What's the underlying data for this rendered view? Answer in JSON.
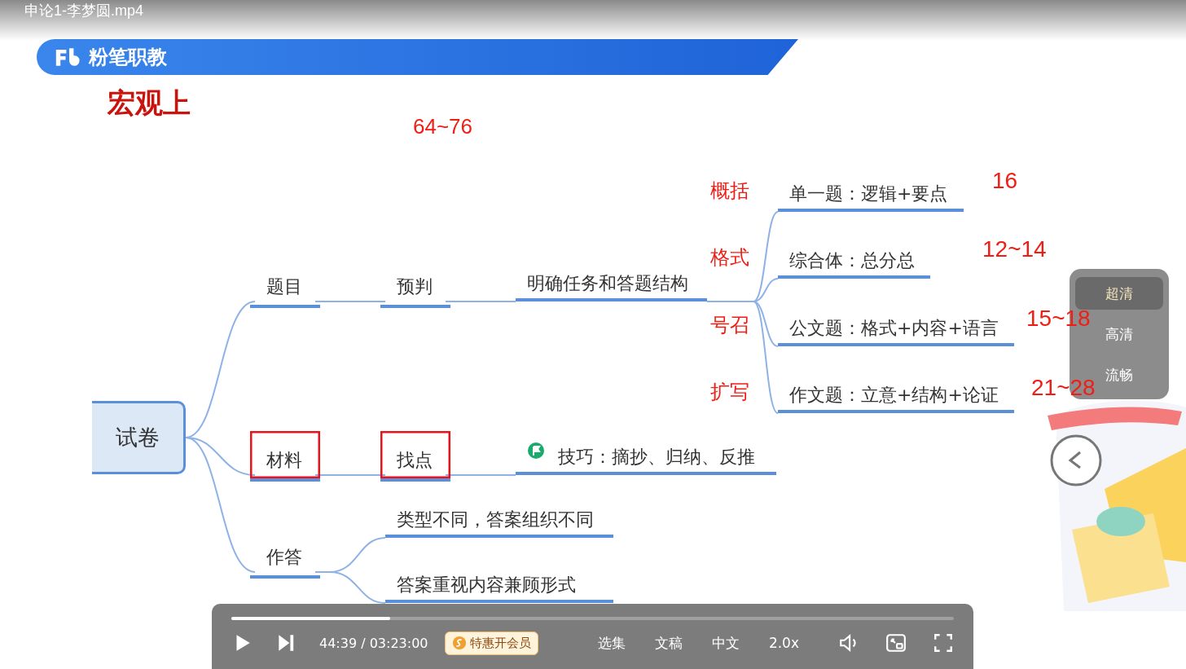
{
  "window": {
    "title": "申论1-李梦圆.mp4"
  },
  "slide": {
    "brand": "粉笔职教",
    "heading": "宏观上",
    "annotation": "64~76",
    "mindmap": {
      "label": "试卷",
      "children": [
        {
          "label": "题目",
          "boxed": false,
          "children": [
            {
              "label": "预判",
              "boxed": false,
              "children": [
                {
                  "label": "明确任务和答题结构",
                  "children": [
                    {
                      "label": "单一题：逻辑+要点",
                      "note": "概括",
                      "score": "16"
                    },
                    {
                      "label": "综合体：总分总",
                      "note": "格式",
                      "score": "12~14"
                    },
                    {
                      "label": "公文题：格式+内容+语言",
                      "note": "号召",
                      "score": "15~18"
                    },
                    {
                      "label": "作文题：立意+结构+论证",
                      "note": "扩写",
                      "score": "21~28"
                    }
                  ]
                }
              ]
            }
          ]
        },
        {
          "label": "材料",
          "boxed": true,
          "children": [
            {
              "label": "找点",
              "boxed": true,
              "children": [
                {
                  "label": "技巧：摘抄、归纳、反推"
                }
              ]
            }
          ]
        },
        {
          "label": "作答",
          "boxed": false,
          "children": [
            {
              "label": "类型不同，答案组织不同"
            },
            {
              "label": "答案重视内容兼顾形式"
            }
          ]
        }
      ]
    }
  },
  "quality_menu": [
    {
      "label": "超清",
      "selected": true
    },
    {
      "label": "高清",
      "selected": false
    },
    {
      "label": "流畅",
      "selected": false
    }
  ],
  "controls": {
    "progress": {
      "level": 0.22
    },
    "time": "44:39 / 03:23:00",
    "vip_button": "特惠开会员",
    "menu": [
      "选集",
      "文稿",
      "中文",
      "2.0x"
    ]
  }
}
